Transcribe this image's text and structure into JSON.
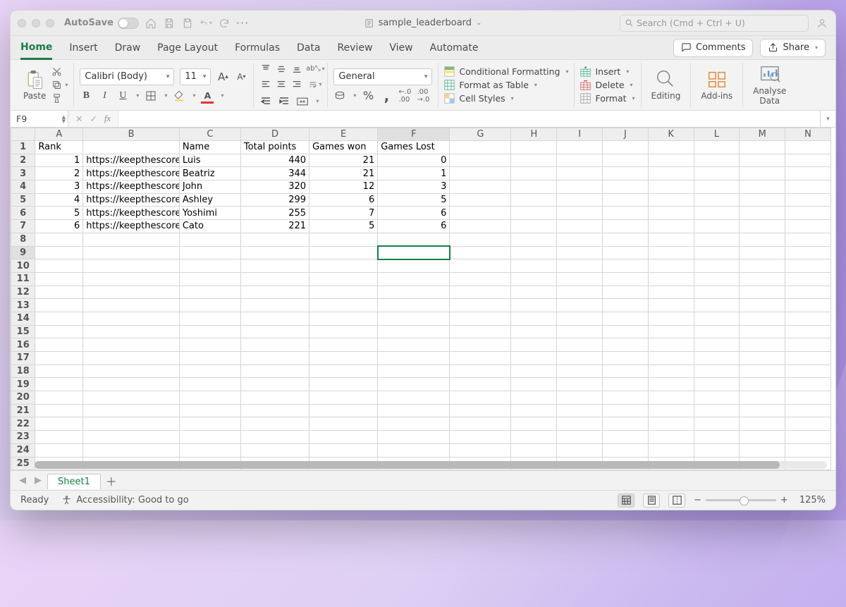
{
  "titlebar": {
    "autosave": "AutoSave",
    "doc_title": "sample_leaderboard",
    "search_placeholder": "Search (Cmd + Ctrl + U)"
  },
  "tabs": {
    "items": [
      "Home",
      "Insert",
      "Draw",
      "Page Layout",
      "Formulas",
      "Data",
      "Review",
      "View",
      "Automate"
    ],
    "comments": "Comments",
    "share": "Share"
  },
  "ribbon": {
    "paste": "Paste",
    "font_name": "Calibri (Body)",
    "font_size": "11",
    "number_format": "General",
    "cond_fmt": "Conditional Formatting",
    "fmt_table": "Format as Table",
    "cell_styles": "Cell Styles",
    "insert": "Insert",
    "delete": "Delete",
    "format": "Format",
    "editing": "Editing",
    "addins": "Add-ins",
    "analyse": "Analyse\nData"
  },
  "formula_bar": {
    "name_box": "F9"
  },
  "columns": [
    "A",
    "B",
    "C",
    "D",
    "E",
    "F",
    "G",
    "H",
    "I",
    "J",
    "K",
    "L",
    "M",
    "N"
  ],
  "row_count": 25,
  "headers": {
    "A": "Rank",
    "C": "Name",
    "D": "Total points",
    "E": "Games won",
    "F": "Games Lost"
  },
  "rows": [
    {
      "rank": 1,
      "url": "https://keepthescore.co",
      "name": "Luis",
      "points": 440,
      "won": 21,
      "lost": 0
    },
    {
      "rank": 2,
      "url": "https://keepthescore.co",
      "name": "Beatriz",
      "points": 344,
      "won": 21,
      "lost": 1
    },
    {
      "rank": 3,
      "url": "https://keepthescore.co",
      "name": "John",
      "points": 320,
      "won": 12,
      "lost": 3
    },
    {
      "rank": 4,
      "url": "https://keepthescore.co",
      "name": "Ashley",
      "points": 299,
      "won": 6,
      "lost": 5
    },
    {
      "rank": 5,
      "url": "https://keepthescore.co",
      "name": "Yoshimi",
      "points": 255,
      "won": 7,
      "lost": 6
    },
    {
      "rank": 6,
      "url": "https://keepthescore.co",
      "name": "Cato",
      "points": 221,
      "won": 5,
      "lost": 6
    }
  ],
  "selected": {
    "col": "F",
    "row": 9
  },
  "sheets": {
    "active": "Sheet1"
  },
  "status": {
    "ready": "Ready",
    "accessibility": "Accessibility: Good to go",
    "zoom": "125%"
  }
}
